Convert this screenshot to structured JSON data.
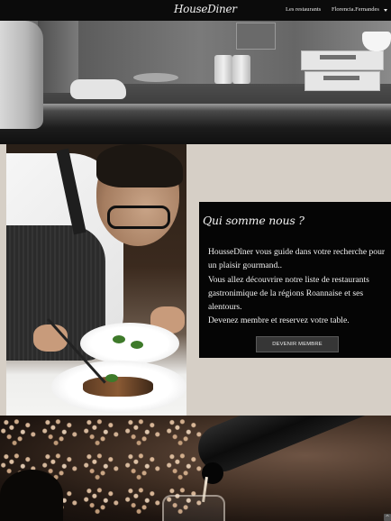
{
  "navbar": {
    "brand": "HouseDiner",
    "links": [
      {
        "label": "Les restaurants"
      },
      {
        "label": "Florencia.Fernandes"
      }
    ],
    "user_menu_icon": "caret-down-icon"
  },
  "hero": {
    "image_subject": "kitchen-counter-photo"
  },
  "about": {
    "image_subject": "chef-plating-dish-photo",
    "title": "Qui somme nous ?",
    "paragraphs": [
      "HousseDîner vous guide dans votre recherche pour un plaisir gourmand..",
      "Vous allez découvrire notre liste de restaurants gastronimique de la régions Roannaise et ses alentours.",
      "Devenez membre et reservez votre table."
    ],
    "button_label": "DEVENIR MEMBRE"
  },
  "bottom": {
    "image_subject": "wine-pouring-photo",
    "scroll_icon": "arrow-up-icon"
  },
  "colors": {
    "navbar_bg": "#0b0b0b",
    "card_bg": "#050505",
    "section_bg": "#d6cfc6",
    "button_bg": "#363636"
  }
}
